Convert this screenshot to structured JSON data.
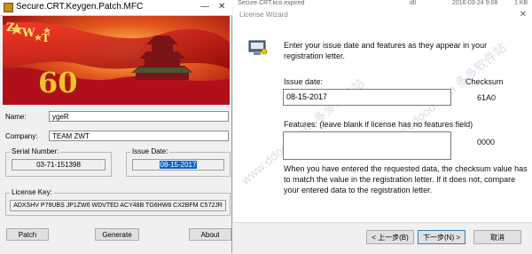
{
  "background": {
    "file_name": "Secure.CRT.kco.expired",
    "file_type": "dll",
    "file_date": "2016-03-24 9:08",
    "file_size": "1 KB"
  },
  "keygen": {
    "title": "Secure.CRT.Keygen.Patch.MFC",
    "banner": {
      "logo_letters": [
        "Z",
        "W",
        "T"
      ],
      "anniversary": "60"
    },
    "name_label": "Name:",
    "name_value": "ygeR",
    "company_label": "Company:",
    "company_value": "TEAM ZWT",
    "serial_label": "Serial Number:",
    "serial_value": "03-71-151398",
    "issue_label": "Issue Date:",
    "issue_value": "08-15-2017",
    "license_label": "License Key:",
    "license_value": "ADXSHV P79UBS JP1ZW6 WDVTED ACY48B TG6HW8 CX2BFM C572JR",
    "buttons": {
      "patch": "Patch",
      "generate": "Generate",
      "about": "About"
    },
    "colors": {
      "banner_red": "#c2141b",
      "banner_gold": "#f0c23a"
    }
  },
  "wizard": {
    "title": "License Wizard",
    "instruction": "Enter your issue date and features as they appear in your registration letter.",
    "issue_date_label": "Issue date:",
    "issue_date_value": "08-15-2017",
    "checksum_label": "Checksum",
    "checksum_value_1": "61A0",
    "features_label": "Features: (leave blank if license has no features field)",
    "features_value": "",
    "checksum_value_2": "0000",
    "help_text": "When you have entered the requested data, the checksum value has to match the value in the registration letter.  If it does not, compare your entered data to the registration letter.",
    "buttons": {
      "back": "< 上一步(B)",
      "next": "下一步(N) >",
      "cancel": "取消"
    },
    "watermark": "www.ddooo.com 多多软件站"
  }
}
